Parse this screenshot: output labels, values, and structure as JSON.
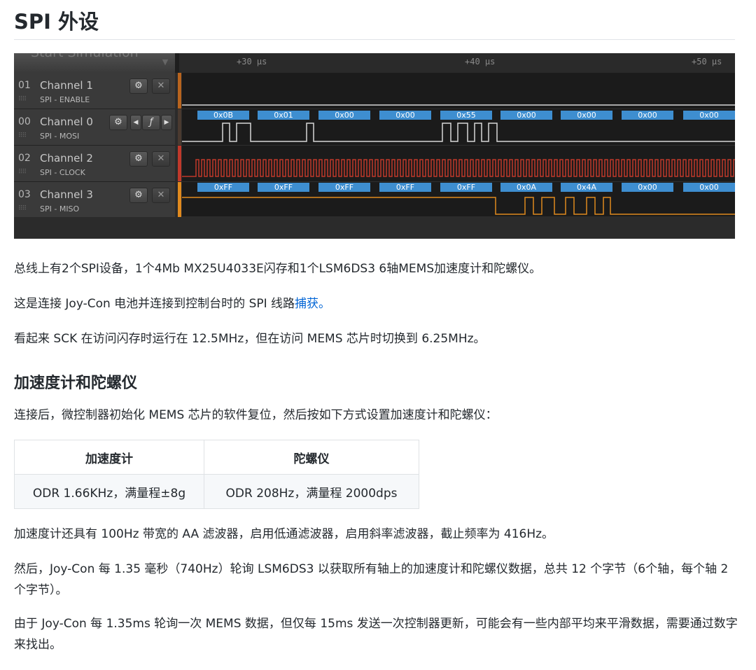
{
  "heading": "SPI 外设",
  "simulator": {
    "start_label": "Start Simulation",
    "time_markers": [
      "+30 µs",
      "+40 µs",
      "+50 µs"
    ],
    "channels": [
      {
        "num": "01",
        "name": "Channel 1",
        "sub": "SPI - ENABLE",
        "color": "#c46a1e"
      },
      {
        "num": "00",
        "name": "Channel 0",
        "sub": "SPI - MOSI",
        "color": "#5a3a2a",
        "bytes": [
          "0x0B",
          "0x01",
          "0x00",
          "0x00",
          "0x55",
          "0x00",
          "0x00",
          "0x00",
          "0x00"
        ]
      },
      {
        "num": "02",
        "name": "Channel 2",
        "sub": "SPI - CLOCK",
        "color": "#c0392b"
      },
      {
        "num": "03",
        "name": "Channel 3",
        "sub": "SPI - MISO",
        "color": "#e08a1e",
        "bytes": [
          "0xFF",
          "0xFF",
          "0xFF",
          "0xFF",
          "0xFF",
          "0x0A",
          "0x4A",
          "0x00",
          "0x00"
        ]
      }
    ],
    "icons": {
      "settings": "gear-icon",
      "close": "close-icon",
      "trigger": "rising-edge-icon"
    }
  },
  "paragraphs": {
    "p1": "总线上有2个SPI设备，1个4Mb MX25U4033E闪存和1个LSM6DS3 6轴MEMS加速度计和陀螺仪。",
    "p2_text": "这是连接 Joy-Con 电池并连接到控制台时的 SPI 线路",
    "p2_link": "捕获。",
    "p3": "看起来 SCK 在访问闪存时运行在 12.5MHz，但在访问 MEMS 芯片时切换到 6.25MHz。"
  },
  "section2": {
    "title": "加速度计和陀螺仪",
    "intro": "连接后，微控制器初始化 MEMS 芯片的软件复位，然后按如下方式设置加速度计和陀螺仪：",
    "table": {
      "headers": [
        "加速度计",
        "陀螺仪"
      ],
      "rows": [
        [
          "ODR 1.66KHz，满量程±8g",
          "ODR 208Hz，满量程 2000dps"
        ]
      ]
    },
    "p_aa": "加速度计还具有 100Hz 带宽的 AA 滤波器，启用低通滤波器，启用斜率滤波器，截止频率为 416Hz。",
    "p_poll": "然后，Joy-Con 每 1.35 毫秒（740Hz）轮询 LSM6DS3 以获取所有轴上的加速度计和陀螺仪数据，总共 12 个字节（6个轴，每个轴 2 个字节）。",
    "p_avg": "由于 Joy-Con 每 1.35ms 轮询一次 MEMS 数据，但仅每 15ms 发送一次控制器更新，可能会有一些内部平均来平滑数据，需要通过数字来找出。"
  },
  "colors": {
    "link": "#0366d6",
    "byte_box": "#3e8ed0",
    "mosi_wave": "#d8d8d8",
    "miso_wave": "#e08a1e",
    "clock_wave": "#c0392b"
  }
}
